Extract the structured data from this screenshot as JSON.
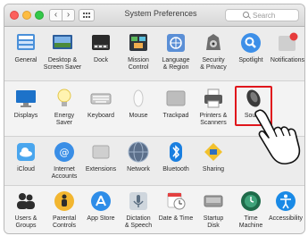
{
  "window": {
    "title": "System Preferences"
  },
  "toolbar": {
    "back": "‹",
    "forward": "›",
    "search_placeholder": "Search"
  },
  "rows": [
    [
      {
        "label": "General",
        "icon": "general-icon"
      },
      {
        "label": "Desktop &\nScreen Saver",
        "icon": "desktop-screen-saver-icon"
      },
      {
        "label": "Dock",
        "icon": "dock-icon"
      },
      {
        "label": "Mission\nControl",
        "icon": "mission-control-icon"
      },
      {
        "label": "Language\n& Region",
        "icon": "language-region-icon"
      },
      {
        "label": "Security\n& Privacy",
        "icon": "security-privacy-icon"
      },
      {
        "label": "Spotlight",
        "icon": "spotlight-icon"
      },
      {
        "label": "Notifications",
        "icon": "notifications-icon"
      }
    ],
    [
      {
        "label": "Displays",
        "icon": "displays-icon"
      },
      {
        "label": "Energy\nSaver",
        "icon": "energy-saver-icon"
      },
      {
        "label": "Keyboard",
        "icon": "keyboard-icon"
      },
      {
        "label": "Mouse",
        "icon": "mouse-icon"
      },
      {
        "label": "Trackpad",
        "icon": "trackpad-icon"
      },
      {
        "label": "Printers &\nScanners",
        "icon": "printers-scanners-icon"
      },
      {
        "label": "Sound",
        "icon": "sound-icon"
      }
    ],
    [
      {
        "label": "iCloud",
        "icon": "icloud-icon"
      },
      {
        "label": "Internet\nAccounts",
        "icon": "internet-accounts-icon"
      },
      {
        "label": "Extensions",
        "icon": "extensions-icon"
      },
      {
        "label": "Network",
        "icon": "network-icon"
      },
      {
        "label": "Bluetooth",
        "icon": "bluetooth-icon"
      },
      {
        "label": "Sharing",
        "icon": "sharing-icon"
      }
    ],
    [
      {
        "label": "Users &\nGroups",
        "icon": "users-groups-icon"
      },
      {
        "label": "Parental\nControls",
        "icon": "parental-controls-icon"
      },
      {
        "label": "App Store",
        "icon": "app-store-icon"
      },
      {
        "label": "Dictation\n& Speech",
        "icon": "dictation-speech-icon"
      },
      {
        "label": "Date & Time",
        "icon": "date-time-icon"
      },
      {
        "label": "Startup\nDisk",
        "icon": "startup-disk-icon"
      },
      {
        "label": "Time\nMachine",
        "icon": "time-machine-icon"
      },
      {
        "label": "Accessibility",
        "icon": "accessibility-icon"
      }
    ]
  ],
  "highlight": {
    "selected": "Sound",
    "color": "#e0161c"
  }
}
